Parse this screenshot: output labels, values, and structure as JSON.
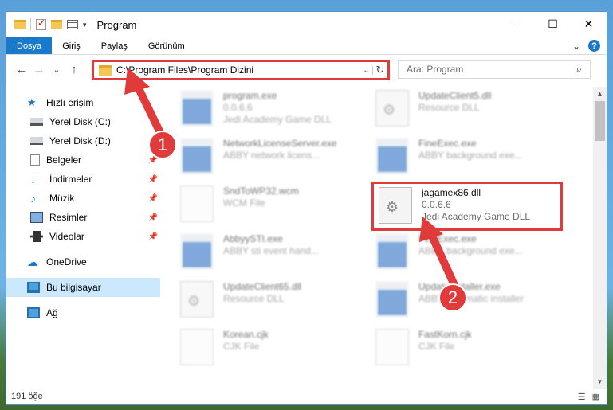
{
  "window": {
    "title": "Program",
    "controls": {
      "minimize": "—",
      "maximize": "☐",
      "close": "✕"
    }
  },
  "ribbon": {
    "tabs": [
      {
        "label": "Dosya",
        "active": true
      },
      {
        "label": "Giriş"
      },
      {
        "label": "Paylaş"
      },
      {
        "label": "Görünüm"
      }
    ],
    "expand_glyph": "⌄",
    "help": "?"
  },
  "navigation": {
    "back": "←",
    "forward": "→",
    "recent": "⌄",
    "up": "↑",
    "address": "C:\\Program Files\\Program Dizini",
    "search_placeholder": "Ara: Program"
  },
  "sidebar": {
    "items": [
      {
        "label": "Hızlı erişim",
        "icon": "star-icon"
      },
      {
        "label": "Yerel Disk (C:)",
        "icon": "drive-icon"
      },
      {
        "label": "Yerel Disk (D:)",
        "icon": "drive-icon"
      },
      {
        "label": "Belgeler",
        "icon": "documents-icon",
        "pinned": true
      },
      {
        "label": "İndirmeler",
        "icon": "download-icon",
        "pinned": true
      },
      {
        "label": "Müzik",
        "icon": "music-icon",
        "pinned": true
      },
      {
        "label": "Resimler",
        "icon": "pictures-icon",
        "pinned": true
      },
      {
        "label": "Videolar",
        "icon": "videos-icon",
        "pinned": true
      },
      {
        "label": "OneDrive",
        "icon": "cloud-icon"
      },
      {
        "label": "Bu bilgisayar",
        "icon": "computer-icon",
        "selected": true
      },
      {
        "label": "Ağ",
        "icon": "network-icon"
      }
    ]
  },
  "files": [
    {
      "name": "program.exe",
      "line2": "0.0.6.6",
      "line3": "Jedi Academy Game DLL",
      "type": "exe"
    },
    {
      "name": "UpdateClient5.dll",
      "line2": "Resource DLL",
      "line3": "",
      "type": "dll"
    },
    {
      "name": "NetworkLicenseServer.exe",
      "line2": "ABBY network licens...",
      "line3": "",
      "type": "exe"
    },
    {
      "name": "FineExec.exe",
      "line2": "ABBY background exe...",
      "line3": "",
      "type": "exe"
    },
    {
      "name": "SndToWP32.wcm",
      "line2": "WCM File",
      "line3": "",
      "type": "doc"
    },
    {
      "name": "jagamex86.dll",
      "line2": "0.0.6.6",
      "line3": "Jedi Academy Game DLL",
      "type": "dll",
      "highlighted": true
    },
    {
      "name": "AbbyySTI.exe",
      "line2": "ABBY sti event hand...",
      "line3": "",
      "type": "exe"
    },
    {
      "name": "FineExec.exe",
      "line2": "ABBY background exe...",
      "line3": "",
      "type": "exe"
    },
    {
      "name": "UpdateClient65.dll",
      "line2": "Resource DLL",
      "line3": "",
      "type": "dll"
    },
    {
      "name": "UpdateInstaller.exe",
      "line2": "ABBY automatic installer",
      "line3": "",
      "type": "exe"
    },
    {
      "name": "Korean.cjk",
      "line2": "CJK File",
      "line3": "",
      "type": "doc"
    },
    {
      "name": "FastKorn.cjk",
      "line2": "CJK File",
      "line3": "",
      "type": "doc"
    }
  ],
  "status": {
    "item_count": "191 öğe"
  },
  "annotations": [
    {
      "number": "1"
    },
    {
      "number": "2"
    }
  ],
  "colors": {
    "accent": "#1979ca",
    "annotation": "#e03a3a",
    "selection": "#cce8ff"
  }
}
